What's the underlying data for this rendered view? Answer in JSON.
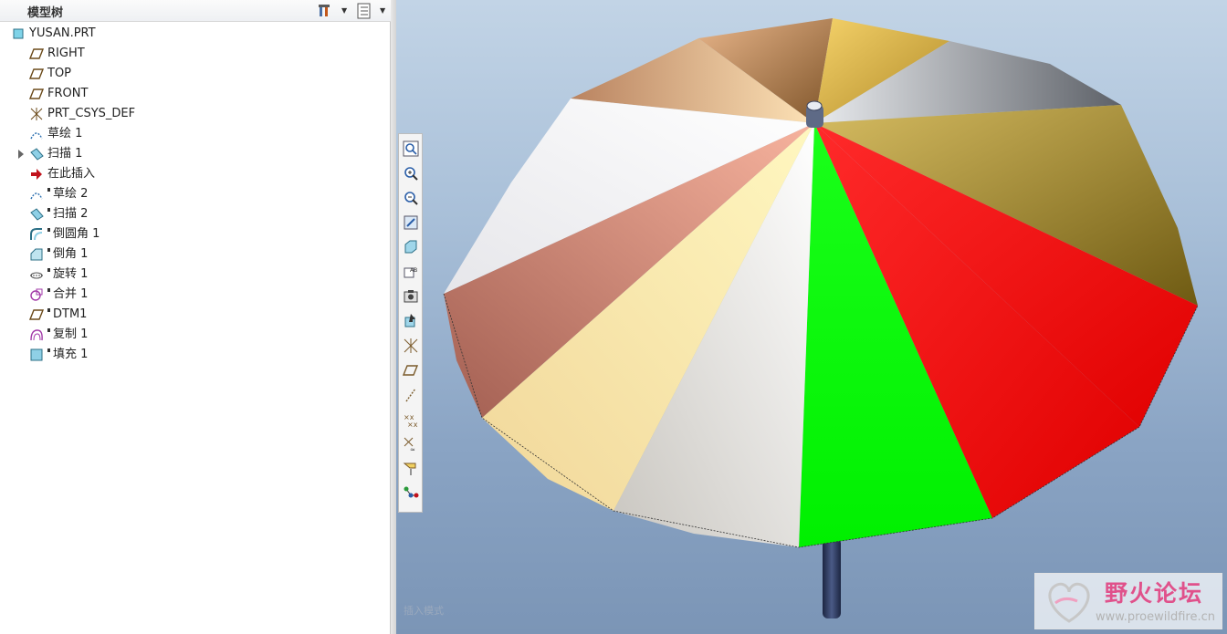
{
  "model_tree": {
    "title": "模型树",
    "items": [
      {
        "label": "YUSAN.PRT",
        "icon": "part-icon"
      },
      {
        "label": "RIGHT",
        "icon": "datum-plane-icon"
      },
      {
        "label": "TOP",
        "icon": "datum-plane-icon"
      },
      {
        "label": "FRONT",
        "icon": "datum-plane-icon"
      },
      {
        "label": "PRT_CSYS_DEF",
        "icon": "coordinate-system-icon"
      },
      {
        "label": "草绘 1",
        "icon": "sketch-icon"
      },
      {
        "label": "扫描 1",
        "icon": "sweep-icon"
      },
      {
        "label": "在此插入",
        "icon": "insert-here-arrow-icon"
      },
      {
        "label": "草绘 2",
        "icon": "sketch-icon"
      },
      {
        "label": "扫描 2",
        "icon": "sweep-icon"
      },
      {
        "label": "倒圆角 1",
        "icon": "round-icon"
      },
      {
        "label": "倒角 1",
        "icon": "chamfer-icon"
      },
      {
        "label": "旋转 1",
        "icon": "revolve-icon"
      },
      {
        "label": "合并 1",
        "icon": "merge-icon"
      },
      {
        "label": "DTM1",
        "icon": "datum-plane-icon"
      },
      {
        "label": "复制 1",
        "icon": "copy-icon"
      },
      {
        "label": "填充 1",
        "icon": "fill-icon"
      }
    ]
  },
  "toolbar_icons": [
    "refit-icon",
    "zoom-in-icon",
    "zoom-out-icon",
    "repaint-icon",
    "shading-icon",
    "saved-views-icon",
    "layers-icon",
    "spin-center-icon",
    "csys-display-icon",
    "plane-display-icon",
    "axis-display-icon",
    "point-display-icon",
    "csys-tag-icon",
    "annotation-display-icon",
    "network-icon"
  ],
  "status_hint": "插入模式",
  "watermark": {
    "title": "野火论坛",
    "url": "www.proewildfire.cn"
  },
  "colors": {
    "viewport_top": "#c2d4e6",
    "viewport_bottom": "#7b95b6",
    "panel_green": "#00ff00",
    "panel_red": "#ff0000",
    "panel_olive": "#b8a030",
    "panel_white": "#f3f3f3",
    "panel_salmon": "#e3917a",
    "panel_cream": "#f7e9b1",
    "panel_gray": "#a9adb2",
    "panel_brown": "#9a6a3e",
    "handle": "#2c3a5e"
  }
}
